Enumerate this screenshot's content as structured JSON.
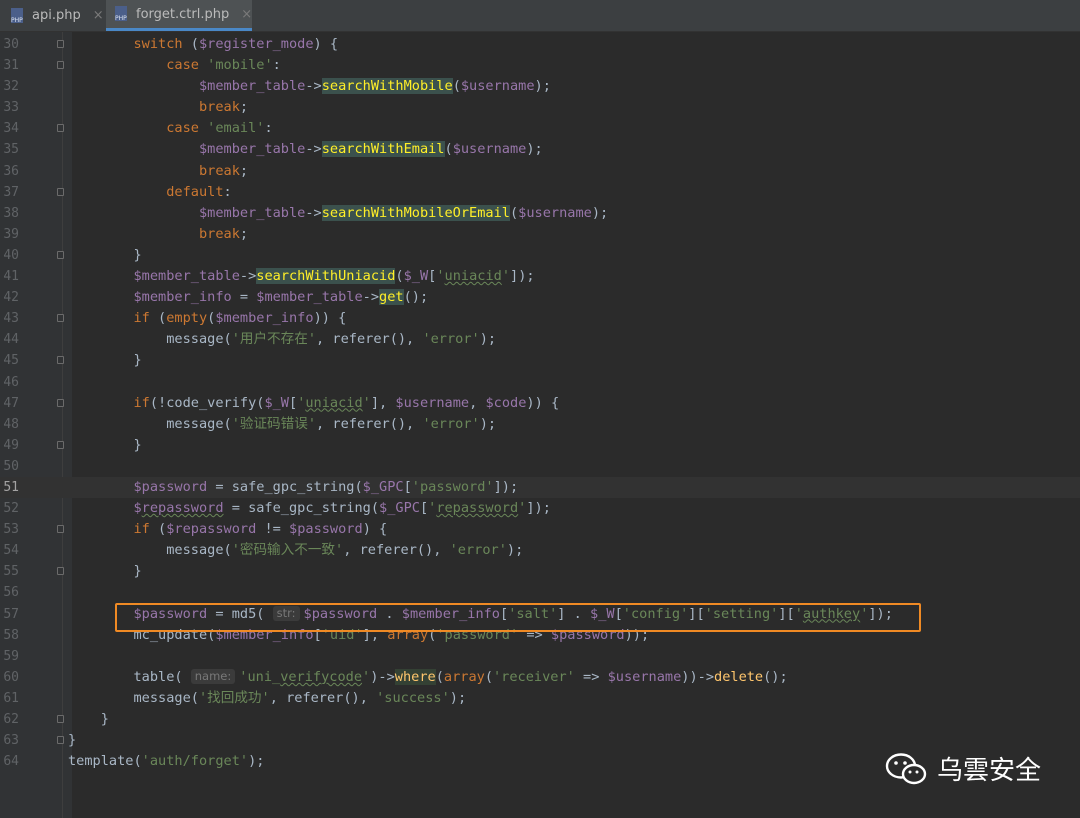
{
  "tabs": [
    {
      "label": "api.php",
      "icon": "php-file-icon",
      "active": false
    },
    {
      "label": "forget.ctrl.php",
      "icon": "php-file-icon",
      "active": true
    }
  ],
  "tab_close_glyph": "×",
  "file_icon_text": "PHP",
  "lines": [
    {
      "n": "30",
      "html": "        <span class=\"kw\">switch</span> (<span class=\"var\">$register_mode</span>) {"
    },
    {
      "n": "31",
      "html": "            <span class=\"kw\">case</span> <span class=\"str\">'mobile'</span>:"
    },
    {
      "n": "32",
      "html": "                <span class=\"var\">$member_table</span>-&gt;<span class=\"hl\">searchWithMobile</span>(<span class=\"var\">$username</span>);"
    },
    {
      "n": "33",
      "html": "                <span class=\"kw\">break</span>;"
    },
    {
      "n": "34",
      "html": "            <span class=\"kw\">case</span> <span class=\"str\">'email'</span>:"
    },
    {
      "n": "35",
      "html": "                <span class=\"var\">$member_table</span>-&gt;<span class=\"hl\">searchWithEmail</span>(<span class=\"var\">$username</span>);"
    },
    {
      "n": "36",
      "html": "                <span class=\"kw\">break</span>;"
    },
    {
      "n": "37",
      "html": "            <span class=\"kw\">default</span>:"
    },
    {
      "n": "38",
      "html": "                <span class=\"var\">$member_table</span>-&gt;<span class=\"hl\">searchWithMobileOrEmail</span>(<span class=\"var\">$username</span>);"
    },
    {
      "n": "39",
      "html": "                <span class=\"kw\">break</span>;"
    },
    {
      "n": "40",
      "html": "        }"
    },
    {
      "n": "41",
      "html": "        <span class=\"var\">$member_table</span>-&gt;<span class=\"hl\">searchWithUniacid</span>(<span class=\"var\">$_W</span>[<span class=\"str\">'<span class=\"spell\">uniacid</span>'</span>]);"
    },
    {
      "n": "42",
      "html": "        <span class=\"var\">$member_info</span> = <span class=\"var\">$member_table</span>-&gt;<span class=\"hl\">get</span>();"
    },
    {
      "n": "43",
      "html": "        <span class=\"kw\">if</span> (<span class=\"kw\">empty</span>(<span class=\"var\">$member_info</span>)) {"
    },
    {
      "n": "44",
      "html": "            message(<span class=\"str\">'用户不存在'</span>, referer(), <span class=\"str\">'error'</span>);"
    },
    {
      "n": "45",
      "html": "        }"
    },
    {
      "n": "46",
      "html": ""
    },
    {
      "n": "47",
      "html": "        <span class=\"kw\">if</span>(!code_verify(<span class=\"var\">$_W</span>[<span class=\"str\">'<span class=\"spell\">uniacid</span>'</span>], <span class=\"var\">$username</span>, <span class=\"var\">$code</span>)) {"
    },
    {
      "n": "48",
      "html": "            message(<span class=\"str\">'验证码错误'</span>, referer(), <span class=\"str\">'error'</span>);"
    },
    {
      "n": "49",
      "html": "        }"
    },
    {
      "n": "50",
      "html": ""
    },
    {
      "n": "51",
      "html": "        <span class=\"var\">$password</span> = safe_gpc_string(<span class=\"var\">$_GPC</span>[<span class=\"str\">'password'</span>]);",
      "current": true
    },
    {
      "n": "52",
      "html": "        <span class=\"var\">$<span class=\"spell\">repassword</span></span> = safe_gpc_string(<span class=\"var\">$_GPC</span>[<span class=\"str\">'<span class=\"spell\">repassword</span>'</span>]);"
    },
    {
      "n": "53",
      "html": "        <span class=\"kw\">if</span> (<span class=\"var\">$repassword</span> != <span class=\"var\">$password</span>) {"
    },
    {
      "n": "54",
      "html": "            message(<span class=\"str\">'密码输入不一致'</span>, referer(), <span class=\"str\">'error'</span>);"
    },
    {
      "n": "55",
      "html": "        }"
    },
    {
      "n": "56",
      "html": ""
    },
    {
      "n": "57",
      "html": "        <span class=\"var\">$password</span> = md5( <span class=\"hint\">str:</span><span class=\"var\">$password</span> . <span class=\"var\">$member_info</span>[<span class=\"str\">'salt'</span>] . <span class=\"var\">$_W</span>[<span class=\"str\">'config'</span>][<span class=\"str\">'setting'</span>][<span class=\"str\">'<span class=\"spell\">authkey</span>'</span>]);"
    },
    {
      "n": "58",
      "html": "        mc_update(<span class=\"var\">$member_info</span>[<span class=\"str\">'uid'</span>], <span class=\"kw\">array</span>(<span class=\"str\">'password'</span> =&gt; <span class=\"var\">$password</span>));"
    },
    {
      "n": "59",
      "html": ""
    },
    {
      "n": "60",
      "html": "        table( <span class=\"hint\">name:</span><span class=\"str\">'uni_<span class=\"spell\">verifycode</span>'</span>)-&gt;<span class=\"hlb\">where</span>(<span class=\"kw\">array</span>(<span class=\"str\">'receiver'</span> =&gt; <span class=\"var\">$username</span>))-&gt;<span class=\"fn\">delete</span>();"
    },
    {
      "n": "61",
      "html": "        message(<span class=\"str\">'找回成功'</span>, referer(), <span class=\"str\">'success'</span>);"
    },
    {
      "n": "62",
      "html": "    }"
    },
    {
      "n": "63",
      "html": "}"
    },
    {
      "n": "64",
      "html": "template(<span class=\"str\">'auth/forget'</span>);"
    }
  ],
  "fold_markers": [
    "30",
    "31",
    "34",
    "37",
    "40",
    "43",
    "45",
    "47",
    "49",
    "53",
    "55",
    "62",
    "63"
  ],
  "watermark": {
    "text": "乌雲安全",
    "icon": "wechat-icon"
  },
  "colors": {
    "background": "#2b2b2b",
    "keyword": "#cc7832",
    "variable": "#9876aa",
    "string": "#6a8759",
    "highlight_box": "#f08a24"
  }
}
